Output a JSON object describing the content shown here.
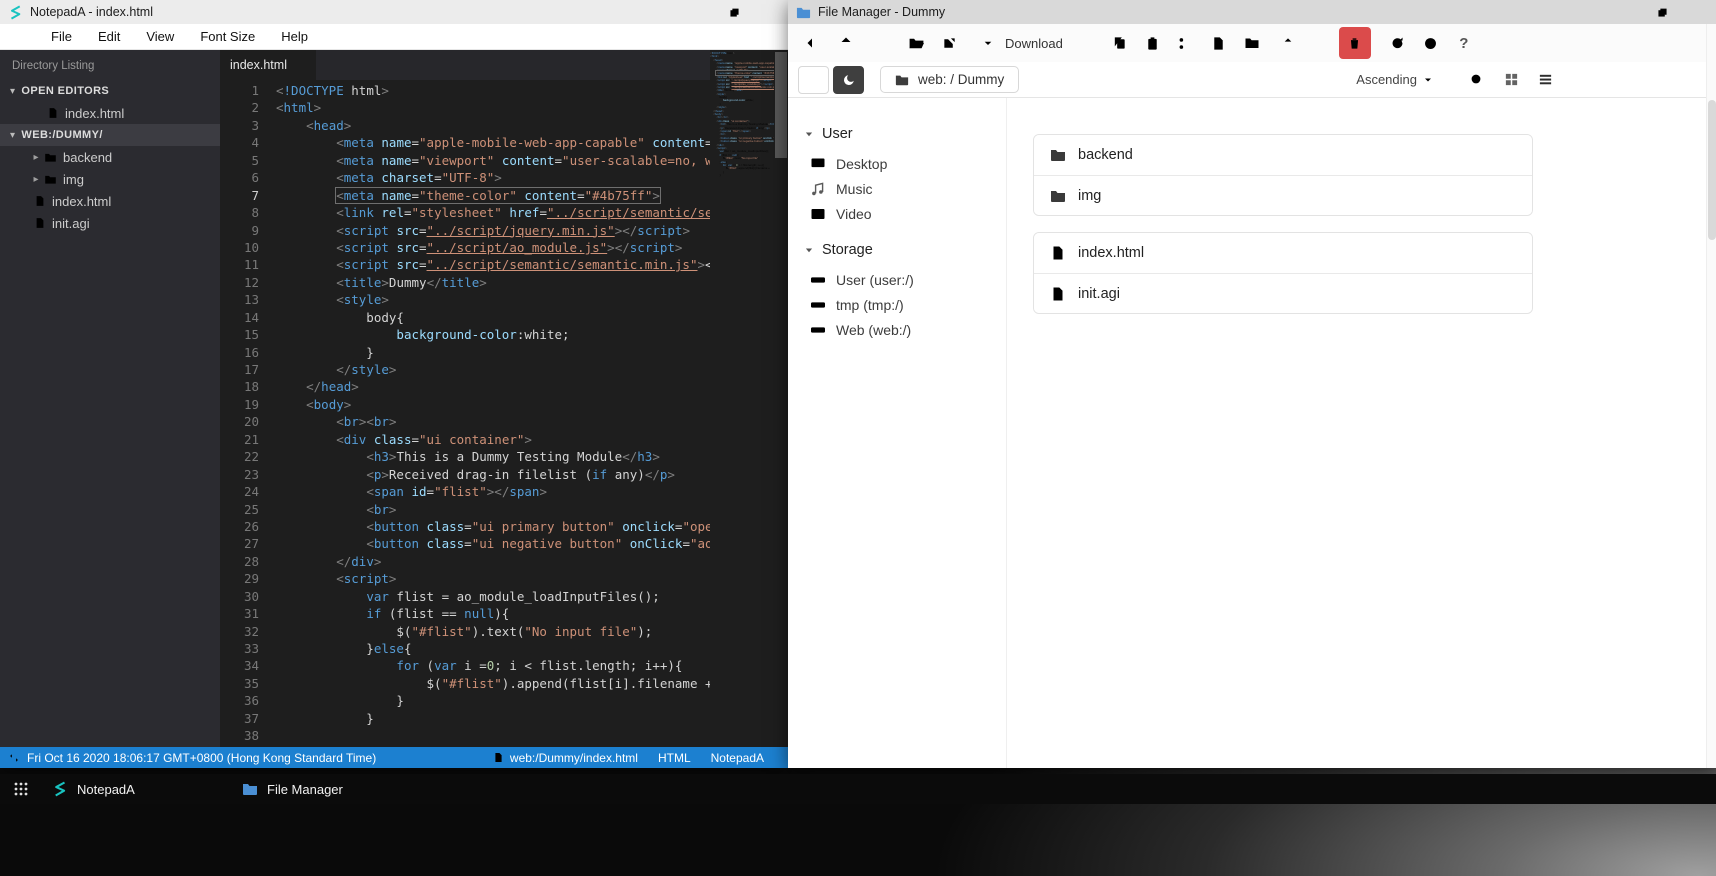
{
  "desktop": {
    "taskbar": {
      "items": [
        {
          "label": "NotepadA",
          "icon": "notepada-logo-icon"
        },
        {
          "label": "File Manager",
          "icon": "folder-icon"
        }
      ]
    }
  },
  "notepada": {
    "window_title": "NotepadA - index.html",
    "menu_items": [
      "File",
      "Edit",
      "View",
      "Font Size",
      "Help"
    ],
    "sidebar": {
      "title": "Directory Listing",
      "open_editors_label": "OPEN EDITORS",
      "open_editors": [
        {
          "name": "index.html"
        }
      ],
      "folder_label": "WEB:/DUMMY/",
      "tree": [
        {
          "name": "backend",
          "type": "folder"
        },
        {
          "name": "img",
          "type": "folder"
        },
        {
          "name": "index.html",
          "type": "file"
        },
        {
          "name": "init.agi",
          "type": "file"
        }
      ]
    },
    "tabs": [
      {
        "label": "index.html",
        "active": true
      }
    ],
    "editor": {
      "active_line": 7,
      "lines": [
        "<!DOCTYPE html>",
        "<html>",
        "    <head>",
        "        <meta name=\"apple-mobile-web-app-capable\" content=\"",
        "        <meta name=\"viewport\" content=\"user-scalable=no, wi",
        "        <meta charset=\"UTF-8\">",
        "        <meta name=\"theme-color\" content=\"#4b75ff\">",
        "        <link rel=\"stylesheet\" href=\"../script/semantic/sem",
        "        <script src=\"../script/jquery.min.js\"></script>",
        "        <script src=\"../script/ao_module.js\"></script>",
        "        <script src=\"../script/semantic/semantic.min.js\"></",
        "        <title>Dummy</title>",
        "        <style>",
        "            body{",
        "                background-color:white;",
        "            }",
        "        </style>",
        "    </head>",
        "    <body>",
        "        <br><br>",
        "        <div class=\"ui container\">",
        "            <h3>This is a Dummy Testing Module</h3>",
        "            <p>Received drag-in filelist (if any)</p>",
        "            <span id=\"flist\"></span>",
        "            <br>",
        "            <button class=\"ui primary button\" onclick=\"ope",
        "            <button class=\"ui negative button\" onClick=\"ao_",
        "        </div>",
        "        <script>",
        "            var flist = ao_module_loadInputFiles();",
        "            if (flist == null){",
        "                $(\"#flist\").text(\"No input file\");",
        "            }else{",
        "                for (var i =0; i < flist.length; i++){",
        "                    $(\"#flist\").append(flist[i].filename + ",
        "                }",
        "            }",
        ""
      ]
    },
    "statusbar": {
      "left": "Fri Oct 16 2020 18:06:17 GMT+0800 (Hong Kong Standard Time)",
      "file_path": "web:/Dummy/index.html",
      "language": "HTML",
      "app": "NotepadA"
    }
  },
  "filemanager": {
    "window_title": "File Manager - Dummy",
    "toolbar": {
      "breadcrumb": "web: / Dummy",
      "sort_label": "Ascending"
    },
    "toolbar_buttons": [
      {
        "name": "back",
        "icon": "arrow-left-icon"
      },
      {
        "name": "up",
        "icon": "arrow-up-icon"
      },
      {
        "name": "open",
        "icon": "folder-open-icon"
      },
      {
        "name": "open-in-new-window",
        "icon": "external-link-icon"
      },
      {
        "name": "download",
        "icon": "download-icon",
        "label": "Download"
      },
      {
        "name": "copy",
        "icon": "copy-icon"
      },
      {
        "name": "paste",
        "icon": "paste-icon"
      },
      {
        "name": "cut",
        "icon": "scissors-icon"
      },
      {
        "name": "new-file",
        "icon": "file-icon"
      },
      {
        "name": "new-folder",
        "icon": "folder-icon"
      },
      {
        "name": "upload",
        "icon": "upload-icon"
      },
      {
        "name": "rename",
        "icon": "text-cursor-icon"
      },
      {
        "name": "delete",
        "icon": "trash-icon"
      },
      {
        "name": "refresh",
        "icon": "refresh-icon"
      },
      {
        "name": "properties",
        "icon": "info-icon"
      },
      {
        "name": "help",
        "icon": "question-icon",
        "label": "?"
      }
    ],
    "sidebar": {
      "sections": [
        {
          "label": "User",
          "items": [
            {
              "label": "Desktop",
              "icon": "monitor-icon"
            },
            {
              "label": "Music",
              "icon": "music-icon"
            },
            {
              "label": "Video",
              "icon": "film-icon"
            }
          ]
        },
        {
          "label": "Storage",
          "items": [
            {
              "label": "User (user:/)",
              "icon": "hdd-icon"
            },
            {
              "label": "tmp (tmp:/)",
              "icon": "hdd-icon"
            },
            {
              "label": "Web (web:/)",
              "icon": "hdd-icon"
            }
          ]
        }
      ]
    },
    "file_groups": [
      {
        "items": [
          {
            "name": "backend",
            "icon": "folder-solid-icon"
          },
          {
            "name": "img",
            "icon": "folder-solid-icon"
          }
        ]
      },
      {
        "items": [
          {
            "name": "index.html",
            "icon": "file-code-icon"
          },
          {
            "name": "init.agi",
            "icon": "file-plain-icon"
          }
        ]
      }
    ]
  }
}
